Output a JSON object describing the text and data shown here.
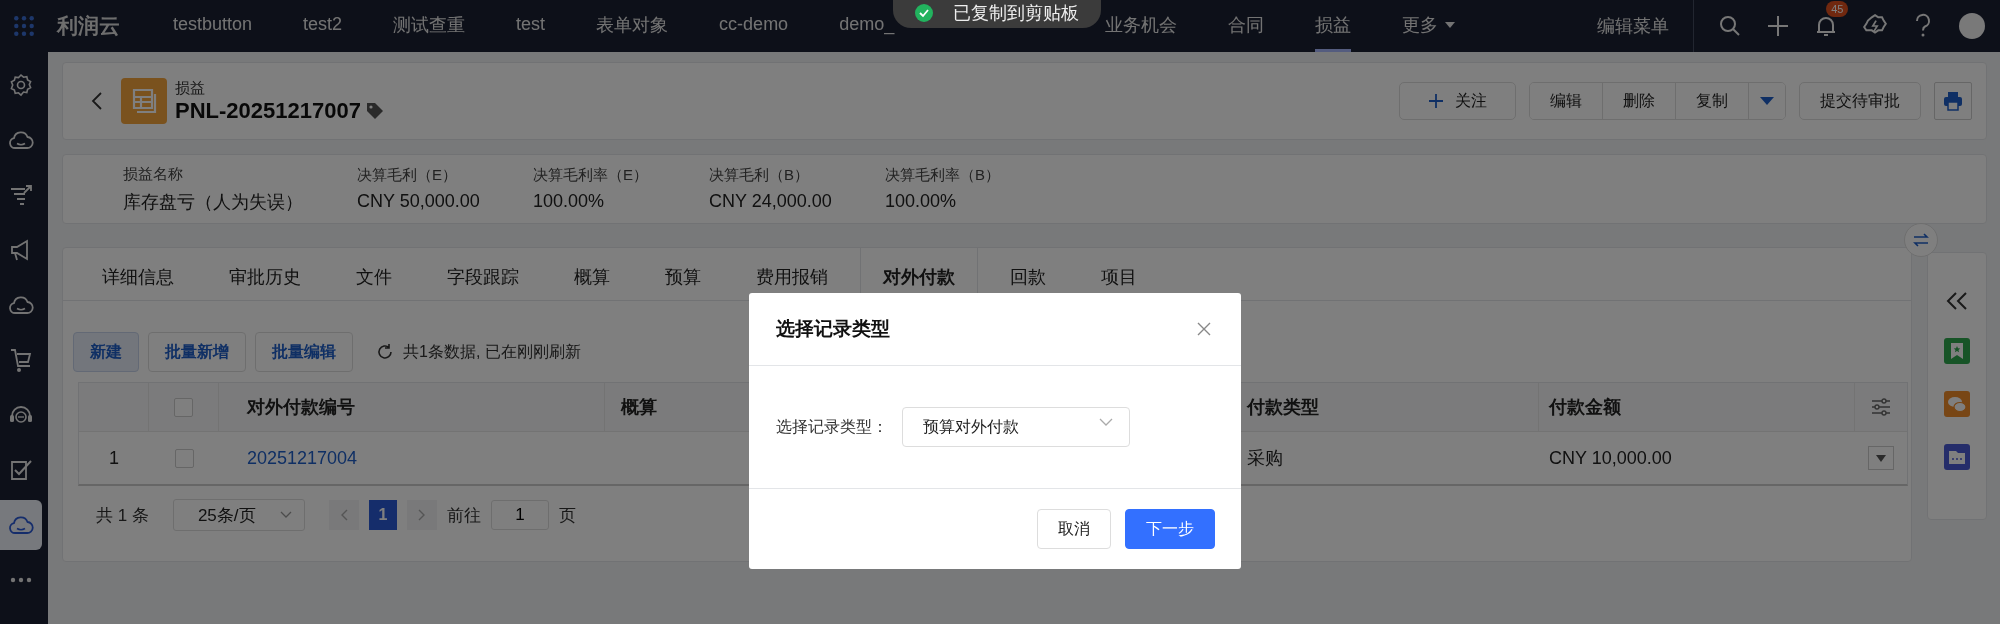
{
  "toast": {
    "text": "已复制到剪贴板"
  },
  "top_bar": {
    "logo": "利润云",
    "nav": [
      {
        "label": "testbutton",
        "selected": false
      },
      {
        "label": "test2",
        "selected": false
      },
      {
        "label": "测试查重",
        "selected": false
      },
      {
        "label": "test",
        "selected": false
      },
      {
        "label": "表单对象",
        "selected": false
      },
      {
        "label": "cc-demo",
        "selected": false
      },
      {
        "label": "demo_",
        "selected": false
      },
      {
        "label": "业务机会",
        "selected": false
      },
      {
        "label": "合同",
        "selected": false
      },
      {
        "label": "损益",
        "selected": true
      }
    ],
    "more": "更多",
    "edit_menu": "编辑菜单",
    "notification_count": "45"
  },
  "sidebar": {
    "items": [
      {
        "selected": false
      },
      {
        "selected": false
      },
      {
        "selected": false
      },
      {
        "selected": false
      },
      {
        "selected": false
      },
      {
        "selected": false
      },
      {
        "selected": false
      },
      {
        "selected": false
      },
      {
        "selected": true
      },
      {
        "selected": false
      }
    ]
  },
  "record": {
    "object": "损益",
    "title": "PNL-20251217007",
    "follow": "关注",
    "actions": [
      "编辑",
      "删除",
      "复制"
    ],
    "submit": "提交待审批"
  },
  "summary": [
    {
      "label": "损益名称",
      "value": "库存盘亏（人为失误）"
    },
    {
      "label": "决算毛利（E）",
      "value": "CNY 50,000.00"
    },
    {
      "label": "决算毛利率（E）",
      "value": "100.00%"
    },
    {
      "label": "决算毛利（B）",
      "value": "CNY 24,000.00"
    },
    {
      "label": "决算毛利率（B）",
      "value": "100.00%"
    }
  ],
  "tabs": [
    {
      "label": "详细信息",
      "selected": false
    },
    {
      "label": "审批历史",
      "selected": false
    },
    {
      "label": "文件",
      "selected": false
    },
    {
      "label": "字段跟踪",
      "selected": false
    },
    {
      "label": "概算",
      "selected": false
    },
    {
      "label": "预算",
      "selected": false
    },
    {
      "label": "费用报销",
      "selected": false
    },
    {
      "label": "对外付款",
      "selected": true
    },
    {
      "label": "回款",
      "selected": false
    },
    {
      "label": "项目",
      "selected": false
    }
  ],
  "toolbar": {
    "buttons": [
      {
        "label": "新建",
        "kind": "primary"
      },
      {
        "label": "批量新增",
        "kind": "default"
      },
      {
        "label": "批量编辑",
        "kind": "default"
      }
    ],
    "status": "共1条数据, 已在刚刚刷新"
  },
  "table": {
    "select_all_checked": false,
    "columns": [
      "对外付款编号",
      "概算",
      "付款类型",
      "付款金额"
    ],
    "rows": [
      {
        "index": "1",
        "checked": false,
        "number": "20251217004",
        "payment_type": "采购",
        "amount": "CNY 10,000.00"
      }
    ]
  },
  "pagination": {
    "total": "共 1 条",
    "page_size": "25条/页",
    "pages": [
      {
        "label": "1",
        "selected": true
      }
    ],
    "goto_label": "前往",
    "goto_value": "1",
    "page_unit": "页"
  },
  "dialog": {
    "title": "选择记录类型",
    "field_label": "选择记录类型：",
    "field_value": "预算对外付款",
    "buttons": [
      {
        "label": "取消",
        "kind": "secondary"
      },
      {
        "label": "下一步",
        "kind": "primary"
      }
    ]
  }
}
